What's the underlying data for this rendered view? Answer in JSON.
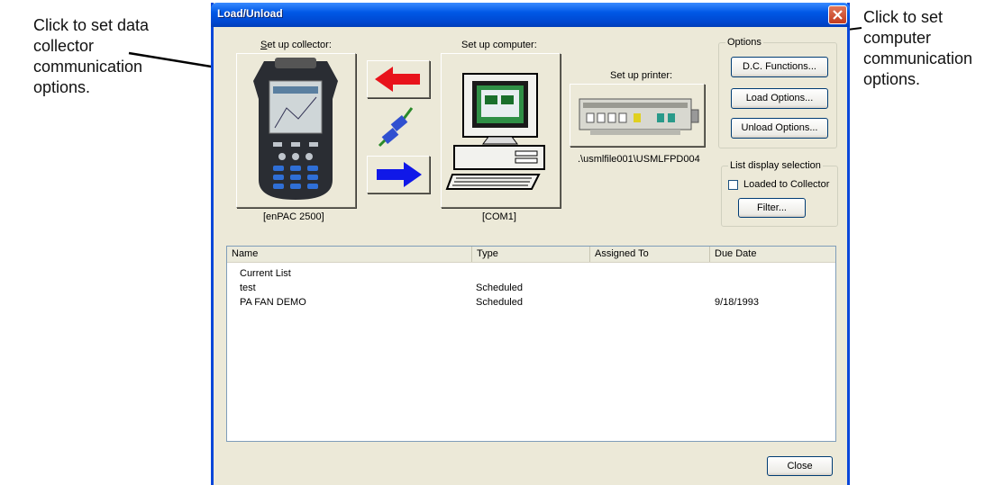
{
  "callouts": {
    "left": "Click to set data\ncollector\ncommunication\noptions.",
    "right": "Click to set\ncomputer\ncommunication\noptions."
  },
  "dialog": {
    "title": "Load/Unload",
    "collector_label": "Set up collector:",
    "collector_name": "[enPAC 2500]",
    "computer_label": "Set up computer:",
    "computer_port": "[COM1]",
    "printer_label": "Set up printer:",
    "printer_path": ".\\usmlfile001\\USMLFPD004",
    "options_title": "Options",
    "dc_functions": "D.C. Functions...",
    "load_options": "Load Options...",
    "unload_options": "Unload Options...",
    "list_display_title": "List display selection",
    "loaded_to_collector": "Loaded to Collector",
    "filter": "Filter...",
    "close": "Close"
  },
  "list": {
    "headers": [
      "Name",
      "Type",
      "Assigned To",
      "Due Date"
    ],
    "rows": [
      {
        "name": "Current List",
        "type": "",
        "assigned": "",
        "due": ""
      },
      {
        "name": "test",
        "type": "Scheduled",
        "assigned": "",
        "due": ""
      },
      {
        "name": "PA FAN DEMO",
        "type": "Scheduled",
        "assigned": "",
        "due": "9/18/1993"
      }
    ]
  },
  "icons": {
    "close": "close-x-icon",
    "left_arrow": "red-left-arrow-icon",
    "right_arrow": "blue-right-arrow-icon",
    "cable": "cable-connector-icon"
  },
  "colors": {
    "titlebar": "#0058e6",
    "dialog_bg": "#ece9d8",
    "arrow_left": "#e8131b",
    "arrow_right": "#1018e8"
  }
}
